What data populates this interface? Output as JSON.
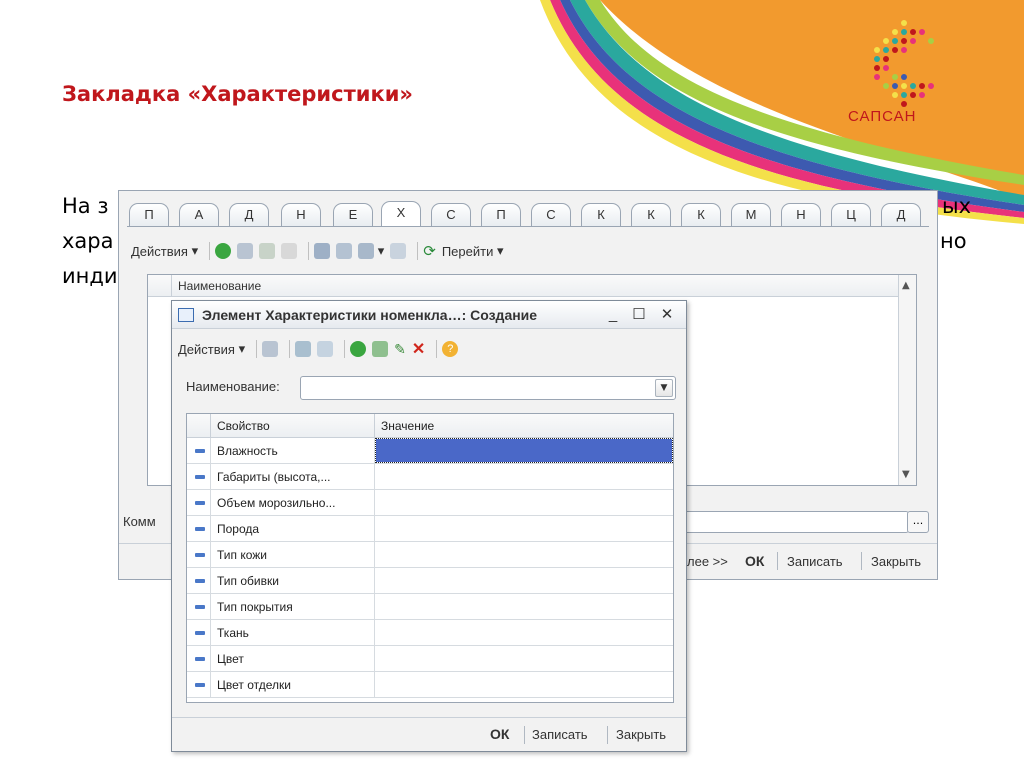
{
  "slide": {
    "title": "Закладка «Характеристики»",
    "logo_text": "САПСАН",
    "body_left": [
      "На з",
      "хара",
      "инди"
    ],
    "body_right": [
      "ых",
      "но"
    ]
  },
  "back_window": {
    "tabs": [
      "П",
      "А",
      "Д",
      "Н",
      "Е",
      "Х",
      "С",
      "П",
      "С",
      "К",
      "К",
      "К",
      "М",
      "Н",
      "Ц",
      "Д"
    ],
    "active_tab_index": 5,
    "toolbar": {
      "actions_label": "Действия",
      "goto_label": "Перейти"
    },
    "list_header": "Наименование",
    "comment_label": "Комм",
    "ellipsis": "...",
    "footer": {
      "more_label": "лее >>",
      "ok_label": "ОК",
      "save_label": "Записать",
      "close_label": "Закрыть"
    }
  },
  "dialog": {
    "title": "Элемент Характеристики номенкла…: Создание",
    "minimize": "_",
    "maximize": "☐",
    "close": "✕",
    "toolbar": {
      "actions_label": "Действия"
    },
    "name_label": "Наименование:",
    "name_value": "",
    "grid": {
      "col_property": "Свойство",
      "col_value": "Значение",
      "rows": [
        {
          "property": "Влажность",
          "value": ""
        },
        {
          "property": "Габариты (высота,...",
          "value": ""
        },
        {
          "property": "Объем морозильно...",
          "value": ""
        },
        {
          "property": "Порода",
          "value": ""
        },
        {
          "property": "Тип кожи",
          "value": ""
        },
        {
          "property": "Тип обивки",
          "value": ""
        },
        {
          "property": "Тип покрытия",
          "value": ""
        },
        {
          "property": "Ткань",
          "value": ""
        },
        {
          "property": "Цвет",
          "value": ""
        },
        {
          "property": "Цвет отделки",
          "value": ""
        }
      ],
      "selected_row": 0
    },
    "footer": {
      "ok_label": "ОК",
      "save_label": "Записать",
      "close_label": "Закрыть"
    }
  },
  "colors": {
    "title_red": "#c0171c",
    "orange": "#f29a2e",
    "selection_blue": "#4a68c8"
  }
}
